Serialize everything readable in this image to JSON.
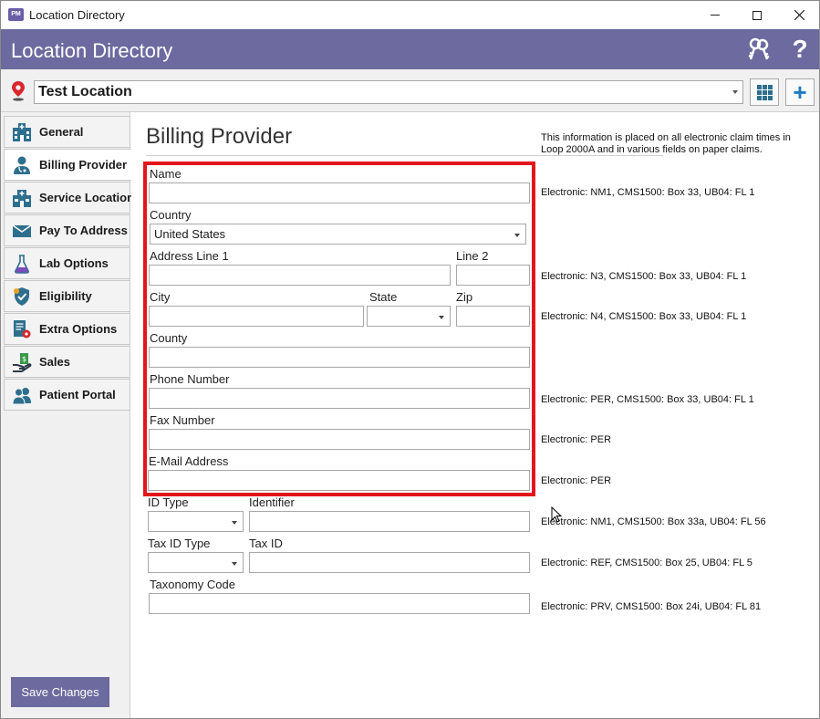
{
  "window": {
    "title": "Location Directory",
    "app_icon_text": "PM"
  },
  "header": {
    "title": "Location Directory"
  },
  "location": {
    "selected": "Test Location"
  },
  "sidebar": {
    "items": [
      {
        "label": "General",
        "icon": "hospital-building-icon"
      },
      {
        "label": "Billing Provider",
        "icon": "doctor-icon"
      },
      {
        "label": "Service Location",
        "icon": "clinic-icon"
      },
      {
        "label": "Pay To Address",
        "icon": "envelope-icon"
      },
      {
        "label": "Lab Options",
        "icon": "flask-icon"
      },
      {
        "label": "Eligibility",
        "icon": "shield-check-icon"
      },
      {
        "label": "Extra Options",
        "icon": "document-gear-icon"
      },
      {
        "label": "Sales",
        "icon": "money-hand-icon"
      },
      {
        "label": "Patient Portal",
        "icon": "users-icon"
      }
    ],
    "active_index": 1,
    "save_label": "Save Changes"
  },
  "main": {
    "title": "Billing Provider",
    "info": "This information is placed on all electronic claim times in Loop 2000A and in various fields on paper claims.",
    "labels": {
      "name": "Name",
      "country": "Country",
      "address1": "Address Line 1",
      "line2": "Line 2",
      "city": "City",
      "state": "State",
      "zip": "Zip",
      "county": "County",
      "phone": "Phone Number",
      "fax": "Fax Number",
      "email": "E-Mail Address",
      "id_type": "ID Type",
      "identifier": "Identifier",
      "tax_id_type": "Tax ID Type",
      "tax_id": "Tax ID",
      "taxonomy": "Taxonomy Code"
    },
    "values": {
      "country": "United States"
    },
    "notes": {
      "name": "Electronic: NM1, CMS1500: Box 33, UB04: FL 1",
      "address": "Electronic: N3, CMS1500: Box 33, UB04: FL 1",
      "city": "Electronic: N4, CMS1500: Box 33, UB04: FL 1",
      "phone": "Electronic: PER, CMS1500: Box 33, UB04: FL 1",
      "fax": "Electronic: PER",
      "email": "Electronic: PER",
      "identifier": "Electronic: NM1, CMS1500: Box 33a, UB04: FL 56",
      "tax_id": "Electronic: REF, CMS1500: Box 25, UB04: FL 5",
      "taxonomy": "Electronic: PRV, CMS1500: Box 24i, UB04: FL 81"
    }
  },
  "colors": {
    "header": "#6c6a9e",
    "highlight": "#e3161c",
    "accent": "#1e7bc2"
  }
}
